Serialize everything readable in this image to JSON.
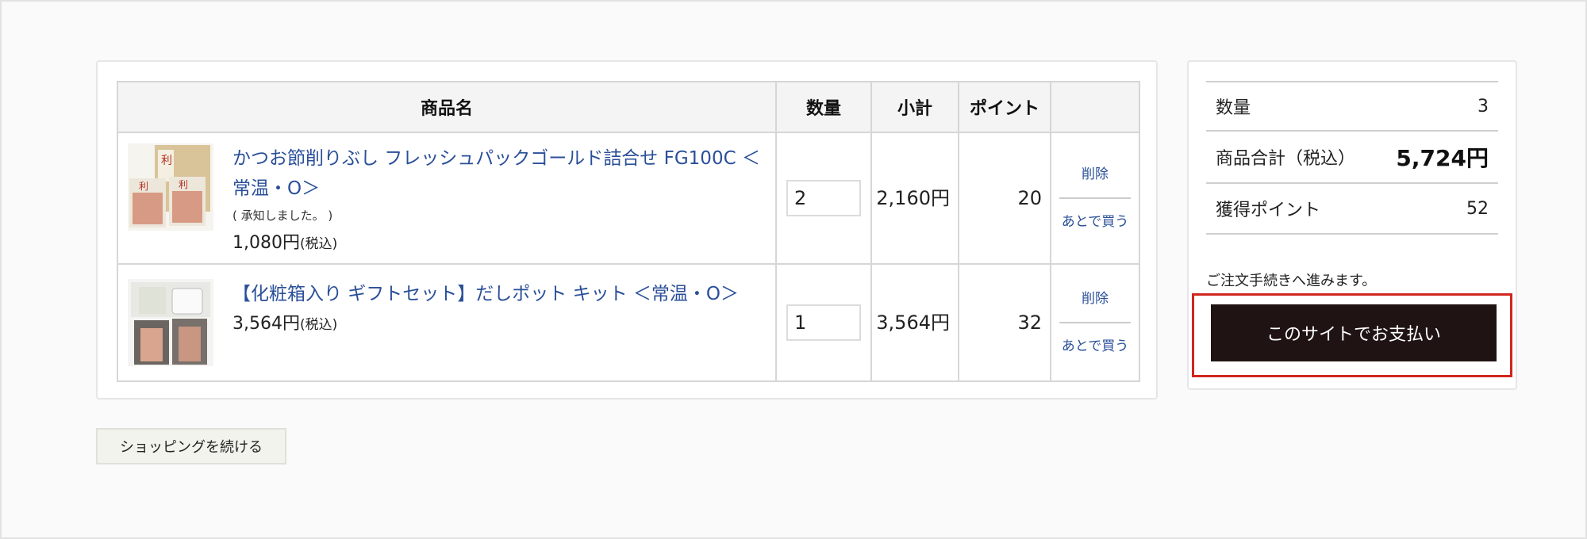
{
  "table": {
    "headers": [
      "商品名",
      "数量",
      "小計",
      "ポイント",
      ""
    ]
  },
  "items": [
    {
      "name": "かつお節削りぶし フレッシュパックゴールド詰合せ FG100C ＜常温・O＞",
      "note": "( 承知しました。 )",
      "price": "1,080円",
      "price_tax": "(税込)",
      "qty": "2",
      "subtotal": "2,160円",
      "points": "20",
      "delete": "削除",
      "later": "あとで買う"
    },
    {
      "name": "【化粧箱入り ギフトセット】だしポット キット ＜常温・O＞",
      "price": "3,564円",
      "price_tax": "(税込)",
      "qty": "1",
      "subtotal": "3,564円",
      "points": "32",
      "delete": "削除",
      "later": "あとで買う"
    }
  ],
  "continue_label": "ショッピングを続ける",
  "summary": {
    "qty_label": "数量",
    "qty_value": "3",
    "total_label": "商品合計（税込）",
    "total_value": "5,724円",
    "points_label": "獲得ポイント",
    "points_value": "52",
    "note": "ご注文手続きへ進みます。",
    "pay_label": "このサイトでお支払い"
  },
  "colors": {
    "link": "#2a4f99",
    "pay_button": "#1f1413",
    "highlight": "#d1261e"
  }
}
